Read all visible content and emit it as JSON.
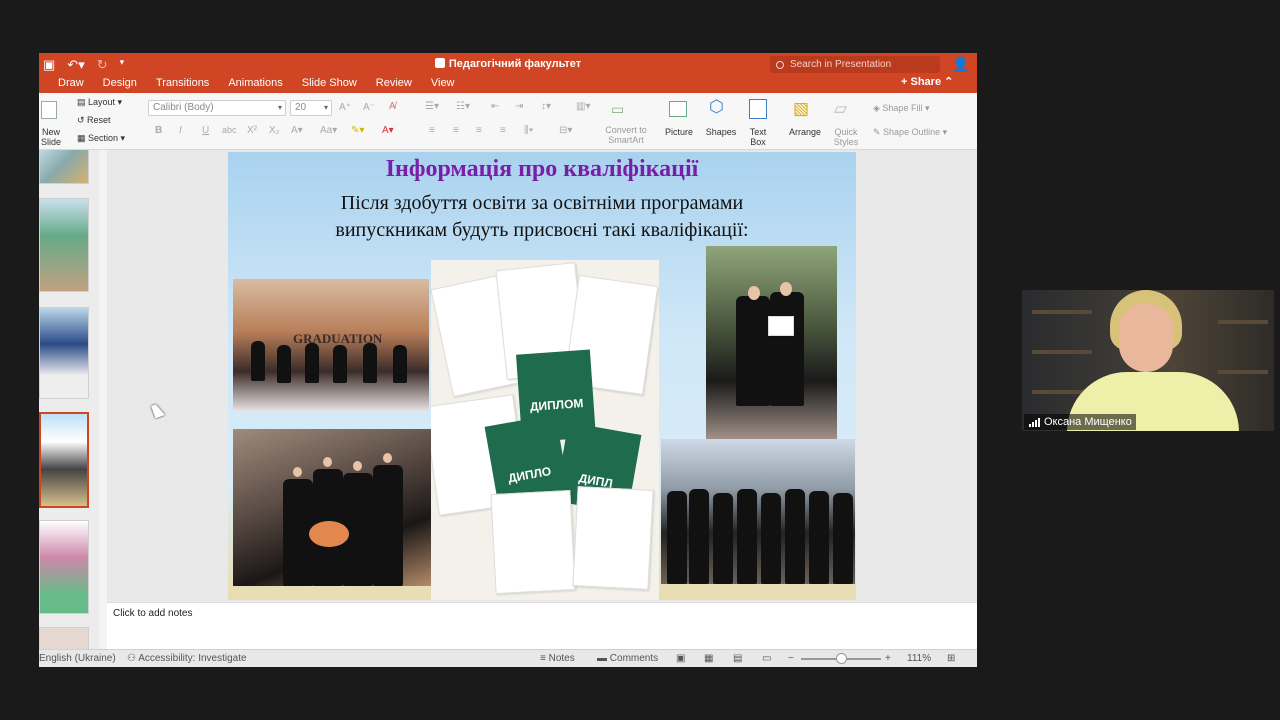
{
  "window": {
    "title": "Педагогічний факультет",
    "search_placeholder": "Search in Presentation",
    "share_label": "Share"
  },
  "tabs": [
    "Draw",
    "Design",
    "Transitions",
    "Animations",
    "Slide Show",
    "Review",
    "View"
  ],
  "ribbon": {
    "new_slide": "New Slide",
    "layout": "Layout",
    "reset": "Reset",
    "section": "Section",
    "font_name": "Calibri (Body)",
    "font_size": "20",
    "convert_smartart": "Convert to SmartArt",
    "picture": "Picture",
    "shapes": "Shapes",
    "text_box": "Text Box",
    "arrange": "Arrange",
    "quick_styles": "Quick Styles",
    "shape_fill": "Shape Fill",
    "shape_outline": "Shape Outline"
  },
  "slide": {
    "title": "Інформація про кваліфікації",
    "subtitle_line1": "Після здобуття освіти за освітніми програмами",
    "subtitle_line2": "випускникам будуть присвоєні такі кваліфікації:",
    "banner": "GRADUATION",
    "diploma1": "ДИПЛОМ",
    "diploma2": "ДИПЛО",
    "diploma3": "ДИПЛ"
  },
  "notes": {
    "placeholder": "Click to add notes"
  },
  "status": {
    "language": "English (Ukraine)",
    "accessibility": "Accessibility: Investigate",
    "notes": "Notes",
    "comments": "Comments",
    "zoom": "111%"
  },
  "video": {
    "participant_name": "Оксана Мищенко"
  },
  "colors": {
    "accent": "#d04523",
    "slide_title": "#7a1ea8"
  }
}
